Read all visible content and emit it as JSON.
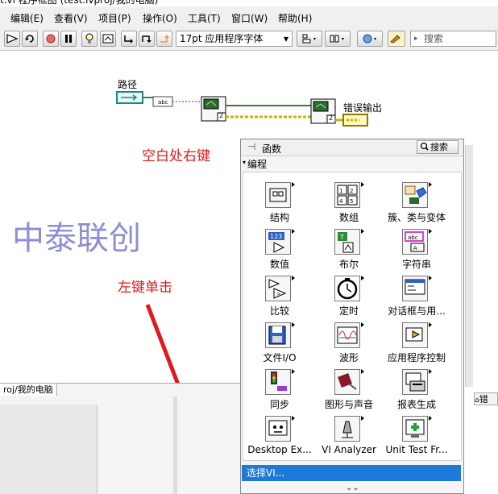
{
  "window": {
    "title": "t.vi 程序框图 (test.lvproj/我的电脑)"
  },
  "menu": [
    "编辑(E)",
    "查看(V)",
    "项目(P)",
    "操作(O)",
    "工具(T)",
    "窗口(W)",
    "帮助(H)"
  ],
  "toolbar": {
    "font": "17pt 应用程序字体",
    "search_placeholder": "搜索"
  },
  "diagram": {
    "path_label": "路径",
    "error_out_label": "错误输出",
    "instruction_right_click": "空白处右键",
    "instruction_left_click": "左键单击",
    "watermark": "中泰联创",
    "node_count_1": "2",
    "node_count_2": "2",
    "path_const": "abc"
  },
  "project_tab": "roj/我的电脑",
  "right_tab": "错",
  "palette": {
    "title": "函数",
    "search_label": "搜索",
    "category": "编程",
    "items": [
      {
        "label": "结构",
        "icon": "structures-icon"
      },
      {
        "label": "数组",
        "icon": "array-icon"
      },
      {
        "label": "簇、类与变体",
        "icon": "cluster-icon"
      },
      {
        "label": "数值",
        "icon": "numeric-icon"
      },
      {
        "label": "布尔",
        "icon": "boolean-icon"
      },
      {
        "label": "字符串",
        "icon": "string-icon"
      },
      {
        "label": "比较",
        "icon": "comparison-icon"
      },
      {
        "label": "定时",
        "icon": "timing-icon"
      },
      {
        "label": "对话框与用...",
        "icon": "dialog-icon"
      },
      {
        "label": "文件I/O",
        "icon": "file-io-icon"
      },
      {
        "label": "波形",
        "icon": "waveform-icon"
      },
      {
        "label": "应用程序控制",
        "icon": "app-control-icon"
      },
      {
        "label": "同步",
        "icon": "sync-icon"
      },
      {
        "label": "图形与声音",
        "icon": "graphics-sound-icon"
      },
      {
        "label": "报表生成",
        "icon": "report-icon"
      },
      {
        "label": "Desktop Ex...",
        "icon": "desktop-execution-icon"
      },
      {
        "label": "VI Analyzer",
        "icon": "vi-analyzer-icon"
      },
      {
        "label": "Unit Test Fr...",
        "icon": "unit-test-icon"
      }
    ],
    "select_vi": "选择VI..."
  },
  "colors": {
    "accent_selection": "#1e7ad8",
    "annotation_red": "#e01a1a",
    "watermark": "#8e8ed4",
    "wire_pink": "#e040c8",
    "wire_error": "#c8b400"
  }
}
